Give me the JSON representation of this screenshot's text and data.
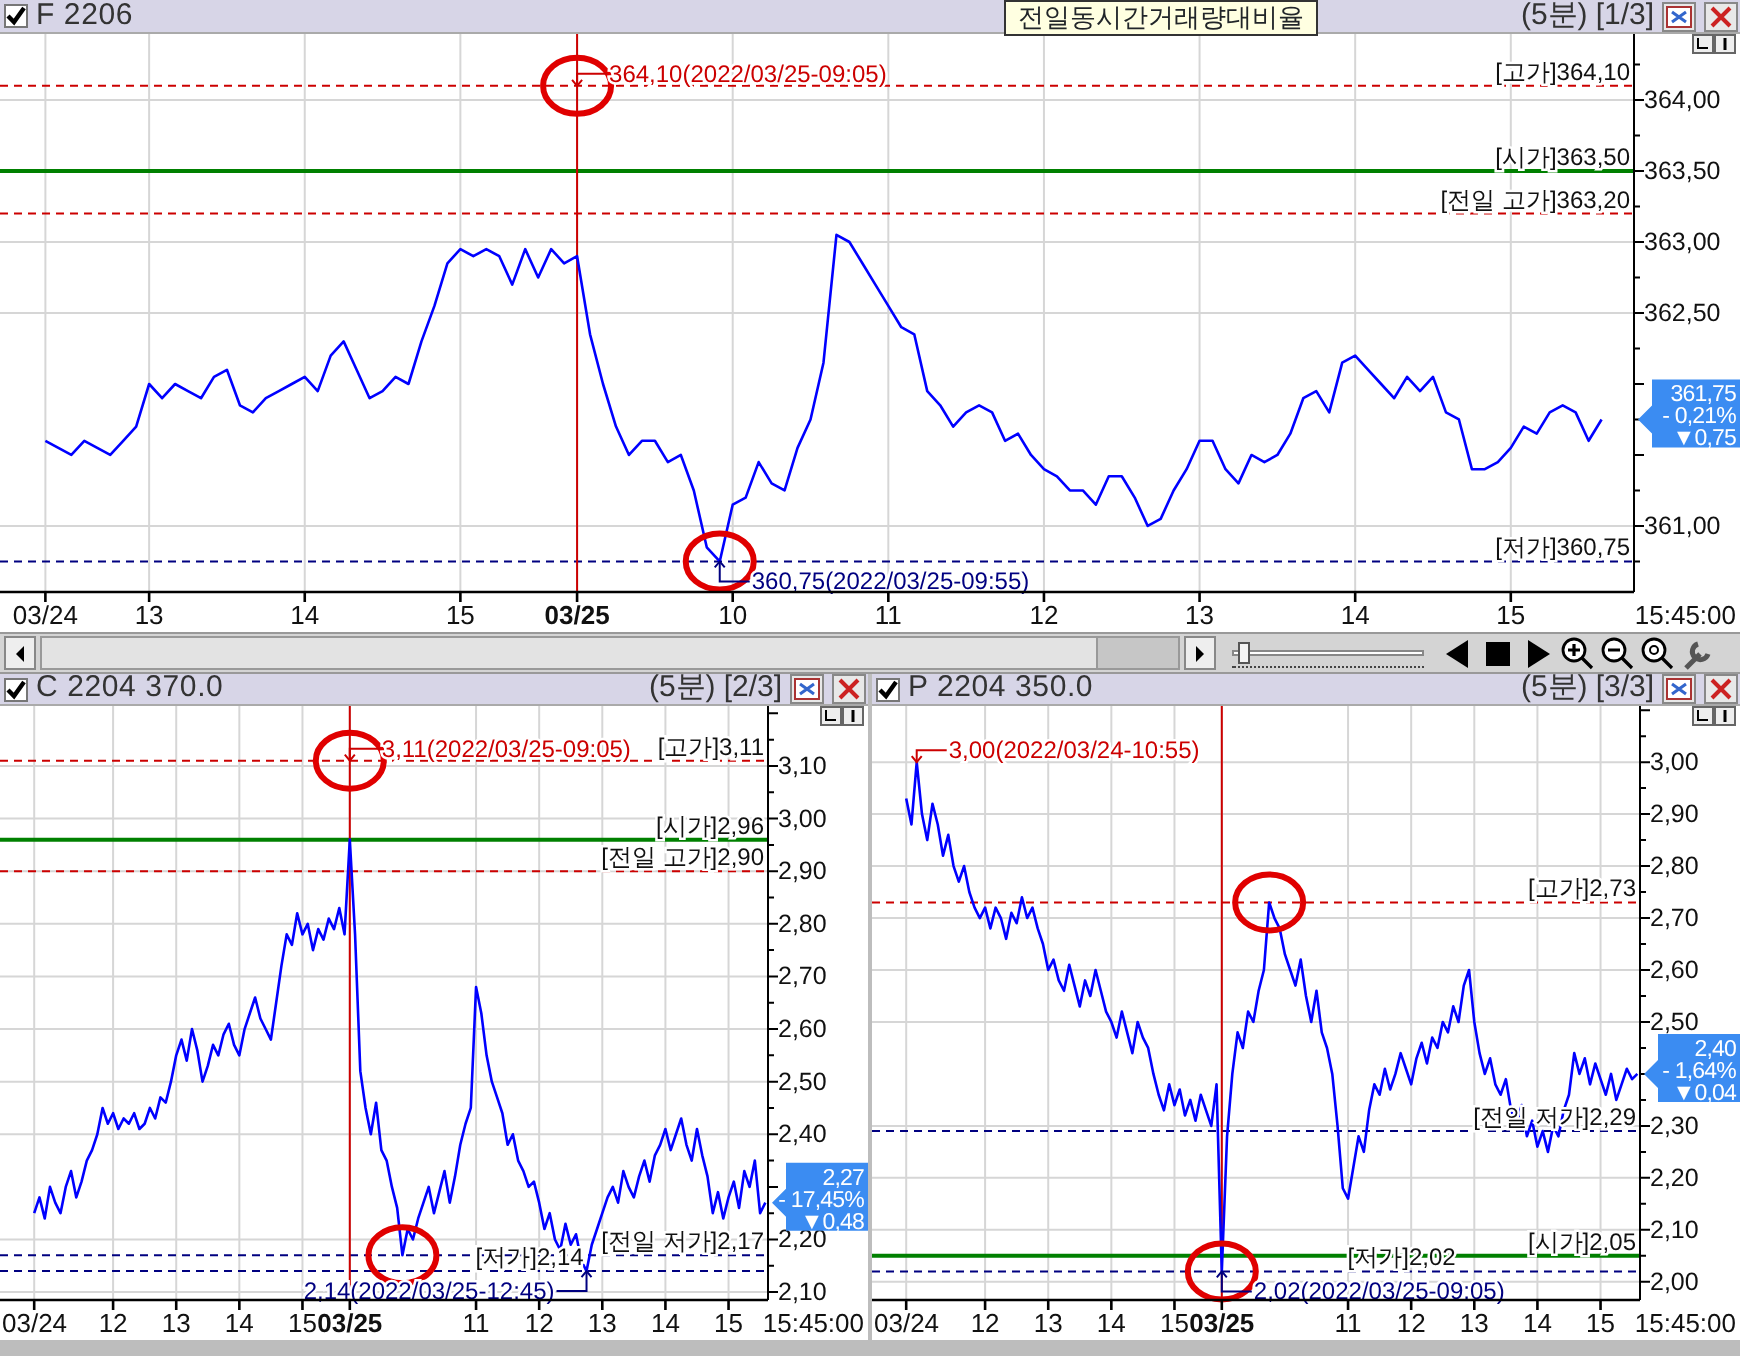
{
  "tooltip": "전일동시간거래량대비율",
  "panels": [
    {
      "header": {
        "checked": true,
        "period": "(5분)",
        "page": "[1/3]"
      },
      "time_label": "15:45:00",
      "badge": {
        "price": "361,75",
        "change": "- 0,21%",
        "diff": "▼0,75"
      },
      "chart_data": {
        "type": "line",
        "grid": true,
        "ylim": [
          360.535,
          364.465
        ],
        "categories": [
          null,
          null,
          null,
          "03/24",
          null,
          null,
          null,
          null,
          null,
          null,
          null,
          "13",
          null,
          null,
          null,
          null,
          null,
          null,
          null,
          null,
          null,
          null,
          null,
          "14",
          null,
          null,
          null,
          null,
          null,
          null,
          null,
          null,
          null,
          null,
          null,
          "15",
          null,
          null,
          null,
          null,
          null,
          null,
          null,
          null,
          "03/25",
          null,
          null,
          null,
          null,
          null,
          null,
          null,
          null,
          null,
          null,
          null,
          "10",
          null,
          null,
          null,
          null,
          null,
          null,
          null,
          null,
          null,
          null,
          null,
          "11",
          null,
          null,
          null,
          null,
          null,
          null,
          null,
          null,
          null,
          null,
          null,
          "12",
          null,
          null,
          null,
          null,
          null,
          null,
          null,
          null,
          null,
          null,
          null,
          "13",
          null,
          null,
          null,
          null,
          null,
          null,
          null,
          null,
          null,
          null,
          null,
          "14",
          null,
          null,
          null,
          null,
          null,
          null,
          null,
          null,
          null,
          null,
          null,
          "15",
          null,
          null,
          null,
          null,
          null,
          null,
          null,
          null,
          null
        ],
        "yticks": [
          {
            "value": 364,
            "label": "364,00"
          },
          {
            "value": 363.5,
            "label": "363,50"
          },
          {
            "value": 363,
            "label": "363,00"
          },
          {
            "value": 362.5,
            "label": "362,50"
          },
          {
            "value": 361,
            "label": "361,00"
          }
        ],
        "series": [
          {
            "name": "F 2206",
            "color": "#0000ff",
            "values": [
              null,
              null,
              null,
              361.6,
              361.55,
              361.5,
              361.6,
              361.55,
              361.5,
              361.6,
              361.7,
              362.0,
              361.9,
              362.0,
              361.95,
              361.9,
              362.05,
              362.1,
              361.85,
              361.8,
              361.9,
              361.95,
              362.0,
              362.05,
              361.95,
              362.2,
              362.3,
              362.1,
              361.9,
              361.95,
              362.05,
              362.0,
              362.3,
              362.55,
              362.85,
              362.95,
              362.9,
              362.95,
              362.9,
              362.7,
              362.95,
              362.75,
              362.95,
              362.85,
              362.9,
              362.35,
              362.0,
              361.7,
              361.5,
              361.6,
              361.6,
              361.45,
              361.5,
              361.25,
              360.85,
              360.75,
              361.15,
              361.2,
              361.45,
              361.3,
              361.25,
              361.55,
              361.75,
              362.15,
              363.05,
              363.0,
              362.85,
              362.7,
              362.55,
              362.4,
              362.35,
              361.95,
              361.85,
              361.7,
              361.8,
              361.85,
              361.8,
              361.6,
              361.65,
              361.5,
              361.4,
              361.35,
              361.25,
              361.25,
              361.15,
              361.35,
              361.35,
              361.2,
              361.0,
              361.05,
              361.25,
              361.4,
              361.6,
              361.6,
              361.4,
              361.3,
              361.5,
              361.45,
              361.5,
              361.65,
              361.9,
              361.95,
              361.8,
              362.15,
              362.2,
              362.1,
              362.0,
              361.9,
              362.05,
              361.95,
              362.05,
              361.8,
              361.75,
              361.4,
              361.4,
              361.45,
              361.55,
              361.7,
              361.65,
              361.8,
              361.85,
              361.8,
              361.6,
              361.75,
              null,
              null
            ]
          }
        ],
        "ref_lines": [
          {
            "axis": "y",
            "value": 364.1,
            "label": "[고가]364,10",
            "color": "#cc0000"
          },
          {
            "axis": "y",
            "value": 363.5,
            "label": "[시가]363,50",
            "color": "#008000"
          },
          {
            "axis": "y",
            "value": 363.2,
            "label": "[전일 고가]363,20",
            "color": "#cc0000"
          },
          {
            "axis": "y",
            "value": 360.75,
            "label": "[저가]360,75",
            "color": "#000080"
          },
          {
            "axis": "x",
            "value": "03/25",
            "color": "#cc0000"
          }
        ],
        "annotations": [
          {
            "x": "03/25",
            "y": 364.1,
            "text": "364,10(2022/03/25-09:05)"
          },
          {
            "y": 360.75,
            "text": "360,75(2022/03/25-09:55)"
          }
        ]
      },
      "ref_line_circled": [
        false,
        false,
        false,
        false,
        false
      ],
      "annotation_circled": [
        true,
        true
      ]
    },
    {
      "header": {
        "checked": true,
        "period": "(5분)",
        "page": "[2/3]"
      },
      "time_label": "15:45:00",
      "badge": {
        "price": "2,27",
        "change": "- 17,45%",
        "diff": "▼0,48"
      },
      "chart_data": {
        "type": "line",
        "grid": true,
        "ylim": [
          2.085,
          3.214
        ],
        "categories": [
          null,
          null,
          null,
          null,
          null,
          null,
          "03/24",
          null,
          null,
          null,
          null,
          null,
          null,
          null,
          null,
          null,
          null,
          null,
          null,
          null,
          null,
          "12",
          null,
          null,
          null,
          null,
          null,
          null,
          null,
          null,
          null,
          null,
          null,
          "13",
          null,
          null,
          null,
          null,
          null,
          null,
          null,
          null,
          null,
          null,
          null,
          "14",
          null,
          null,
          null,
          null,
          null,
          null,
          null,
          null,
          null,
          null,
          null,
          "15",
          null,
          null,
          null,
          null,
          null,
          null,
          null,
          null,
          "03/25",
          null,
          null,
          null,
          null,
          null,
          null,
          null,
          null,
          null,
          null,
          null,
          null,
          null,
          null,
          null,
          null,
          null,
          null,
          null,
          null,
          null,
          null,
          null,
          "11",
          null,
          null,
          null,
          null,
          null,
          null,
          null,
          null,
          null,
          null,
          null,
          "12",
          null,
          null,
          null,
          null,
          null,
          null,
          null,
          null,
          null,
          null,
          null,
          "13",
          null,
          null,
          null,
          null,
          null,
          null,
          null,
          null,
          null,
          null,
          null,
          "14",
          null,
          null,
          null,
          null,
          null,
          null,
          null,
          null,
          null,
          null,
          null,
          "15",
          null,
          null,
          null,
          null,
          null,
          null,
          null
        ],
        "yticks": [
          {
            "value": 3.1,
            "label": "3,10"
          },
          {
            "value": 3.0,
            "label": "3,00"
          },
          {
            "value": 2.9,
            "label": "2,90"
          },
          {
            "value": 2.8,
            "label": "2,80"
          },
          {
            "value": 2.7,
            "label": "2,70"
          },
          {
            "value": 2.6,
            "label": "2,60"
          },
          {
            "value": 2.5,
            "label": "2,50"
          },
          {
            "value": 2.4,
            "label": "2,40"
          },
          {
            "value": 2.2,
            "label": "2,20"
          },
          {
            "value": 2.1,
            "label": "2,10"
          }
        ],
        "series": [
          {
            "name": "C 2204 370.0",
            "color": "#0000ff",
            "values": [
              null,
              null,
              null,
              null,
              null,
              null,
              2.25,
              2.28,
              2.24,
              2.3,
              2.27,
              2.25,
              2.3,
              2.33,
              2.28,
              2.31,
              2.35,
              2.37,
              2.4,
              2.45,
              2.42,
              2.44,
              2.41,
              2.43,
              2.42,
              2.44,
              2.41,
              2.42,
              2.45,
              2.43,
              2.47,
              2.46,
              2.5,
              2.55,
              2.58,
              2.54,
              2.6,
              2.56,
              2.5,
              2.53,
              2.57,
              2.55,
              2.59,
              2.61,
              2.57,
              2.55,
              2.6,
              2.63,
              2.66,
              2.62,
              2.6,
              2.58,
              2.65,
              2.72,
              2.78,
              2.76,
              2.82,
              2.78,
              2.8,
              2.75,
              2.79,
              2.77,
              2.81,
              2.79,
              2.83,
              2.78,
              2.96,
              2.78,
              2.52,
              2.45,
              2.4,
              2.46,
              2.37,
              2.35,
              2.3,
              2.26,
              2.17,
              2.22,
              2.2,
              2.24,
              2.27,
              2.3,
              2.25,
              2.29,
              2.33,
              2.27,
              2.32,
              2.38,
              2.42,
              2.45,
              2.68,
              2.63,
              2.55,
              2.5,
              2.47,
              2.44,
              2.38,
              2.4,
              2.35,
              2.33,
              2.3,
              2.31,
              2.27,
              2.22,
              2.25,
              2.2,
              2.18,
              2.23,
              2.19,
              2.21,
              2.16,
              2.14,
              2.19,
              2.22,
              2.25,
              2.28,
              2.3,
              2.27,
              2.33,
              2.3,
              2.28,
              2.32,
              2.35,
              2.31,
              2.36,
              2.38,
              2.41,
              2.37,
              2.4,
              2.43,
              2.38,
              2.35,
              2.41,
              2.36,
              2.32,
              2.25,
              2.29,
              2.24,
              2.28,
              2.31,
              2.26,
              2.33,
              2.3,
              2.35,
              2.25,
              2.27
            ]
          }
        ],
        "ref_lines": [
          {
            "axis": "y",
            "value": 3.11,
            "label": "[고가]3,11",
            "color": "#cc0000"
          },
          {
            "axis": "y",
            "value": 2.96,
            "label": "[시가]2,96",
            "color": "#008000"
          },
          {
            "axis": "y",
            "value": 2.9,
            "label": "[전일 고가]2,90",
            "color": "#cc0000"
          },
          {
            "axis": "y",
            "value": 2.17,
            "label": "[전일 저가]2,17",
            "color": "#000080"
          },
          {
            "axis": "y",
            "value": 2.14,
            "label": "[저가]2,14",
            "color": "#000080"
          },
          {
            "axis": "x",
            "value": "03/25",
            "color": "#cc0000"
          }
        ],
        "annotations": [
          {
            "x": "03/25",
            "y": 3.11,
            "text": "3,11(2022/03/25-09:05)"
          },
          {
            "y": 2.14,
            "text": "2,14(2022/03/25-12:45)"
          }
        ]
      },
      "ref_line_circled": [
        false,
        false,
        false,
        true,
        false,
        false
      ],
      "annotation_circled": [
        true,
        false
      ]
    },
    {
      "header": {
        "checked": true,
        "period": "(5분)",
        "page": "[3/3]"
      },
      "time_label": "15:45:00",
      "badge": {
        "price": "2,40",
        "change": "- 1,64%",
        "diff": "▼0,04"
      },
      "chart_data": {
        "type": "line",
        "grid": true,
        "ylim": [
          1.965,
          3.108
        ],
        "categories": [
          null,
          null,
          null,
          null,
          null,
          null,
          "03/24",
          null,
          null,
          null,
          null,
          null,
          null,
          null,
          null,
          null,
          null,
          null,
          null,
          null,
          null,
          "12",
          null,
          null,
          null,
          null,
          null,
          null,
          null,
          null,
          null,
          null,
          null,
          "13",
          null,
          null,
          null,
          null,
          null,
          null,
          null,
          null,
          null,
          null,
          null,
          "14",
          null,
          null,
          null,
          null,
          null,
          null,
          null,
          null,
          null,
          null,
          null,
          "15",
          null,
          null,
          null,
          null,
          null,
          null,
          null,
          null,
          "03/25",
          null,
          null,
          null,
          null,
          null,
          null,
          null,
          null,
          null,
          null,
          null,
          null,
          null,
          null,
          null,
          null,
          null,
          null,
          null,
          null,
          null,
          null,
          null,
          "11",
          null,
          null,
          null,
          null,
          null,
          null,
          null,
          null,
          null,
          null,
          null,
          "12",
          null,
          null,
          null,
          null,
          null,
          null,
          null,
          null,
          null,
          null,
          null,
          "13",
          null,
          null,
          null,
          null,
          null,
          null,
          null,
          null,
          null,
          null,
          null,
          "14",
          null,
          null,
          null,
          null,
          null,
          null,
          null,
          null,
          null,
          null,
          null,
          "15",
          null,
          null,
          null,
          null,
          null,
          null,
          null
        ],
        "yticks": [
          {
            "value": 3.0,
            "label": "3,00"
          },
          {
            "value": 2.9,
            "label": "2,90"
          },
          {
            "value": 2.8,
            "label": "2,80"
          },
          {
            "value": 2.7,
            "label": "2,70"
          },
          {
            "value": 2.6,
            "label": "2,60"
          },
          {
            "value": 2.5,
            "label": "2,50"
          },
          {
            "value": 2.3,
            "label": "2,30"
          },
          {
            "value": 2.2,
            "label": "2,20"
          },
          {
            "value": 2.1,
            "label": "2,10"
          },
          {
            "value": 2.0,
            "label": "2,00"
          }
        ],
        "series": [
          {
            "name": "P 2204 350.0",
            "color": "#0000ff",
            "values": [
              null,
              null,
              null,
              null,
              null,
              null,
              2.93,
              2.88,
              3.0,
              2.9,
              2.85,
              2.92,
              2.88,
              2.82,
              2.86,
              2.8,
              2.77,
              2.8,
              2.75,
              2.72,
              2.7,
              2.72,
              2.68,
              2.72,
              2.7,
              2.66,
              2.71,
              2.69,
              2.74,
              2.7,
              2.72,
              2.68,
              2.65,
              2.6,
              2.62,
              2.58,
              2.56,
              2.61,
              2.57,
              2.53,
              2.58,
              2.55,
              2.6,
              2.56,
              2.52,
              2.5,
              2.47,
              2.52,
              2.48,
              2.44,
              2.5,
              2.47,
              2.45,
              2.4,
              2.36,
              2.33,
              2.38,
              2.34,
              2.37,
              2.32,
              2.35,
              2.31,
              2.36,
              2.33,
              2.3,
              2.38,
              2.02,
              2.28,
              2.4,
              2.48,
              2.45,
              2.52,
              2.5,
              2.56,
              2.6,
              2.73,
              2.7,
              2.68,
              2.63,
              2.6,
              2.57,
              2.62,
              2.55,
              2.5,
              2.56,
              2.48,
              2.45,
              2.4,
              2.3,
              2.18,
              2.16,
              2.22,
              2.28,
              2.25,
              2.33,
              2.38,
              2.36,
              2.41,
              2.37,
              2.4,
              2.44,
              2.41,
              2.38,
              2.43,
              2.46,
              2.42,
              2.47,
              2.45,
              2.5,
              2.48,
              2.53,
              2.5,
              2.57,
              2.6,
              2.5,
              2.44,
              2.4,
              2.43,
              2.38,
              2.36,
              2.39,
              2.33,
              2.3,
              2.34,
              2.28,
              2.31,
              2.26,
              2.29,
              2.25,
              2.3,
              2.28,
              2.33,
              2.36,
              2.44,
              2.4,
              2.43,
              2.38,
              2.42,
              2.39,
              2.36,
              2.4,
              2.35,
              2.38,
              2.41,
              2.39,
              2.4
            ]
          }
        ],
        "ref_lines": [
          {
            "axis": "y",
            "value": 2.73,
            "label": "[고가]2,73",
            "color": "#cc0000"
          },
          {
            "axis": "y",
            "value": 2.29,
            "label": "[전일 저가]2,29",
            "color": "#000080"
          },
          {
            "axis": "y",
            "value": 2.05,
            "label": "[시가]2,05",
            "color": "#008000"
          },
          {
            "axis": "y",
            "value": 2.02,
            "label": "[저가]2,02",
            "color": "#000080"
          },
          {
            "axis": "x",
            "value": "03/25",
            "color": "#cc0000"
          }
        ],
        "annotations": [
          "3,00(2022/03/24-10:55)",
          {
            "x": "03/25",
            "y": 2.02,
            "text": "2,02(2022/03/25-09:05)"
          }
        ]
      },
      "ref_line_circled": [
        true,
        false,
        false,
        false,
        false
      ],
      "annotation_circled": [
        false,
        true
      ]
    }
  ],
  "zoom_slider": {
    "level": 0.03
  }
}
